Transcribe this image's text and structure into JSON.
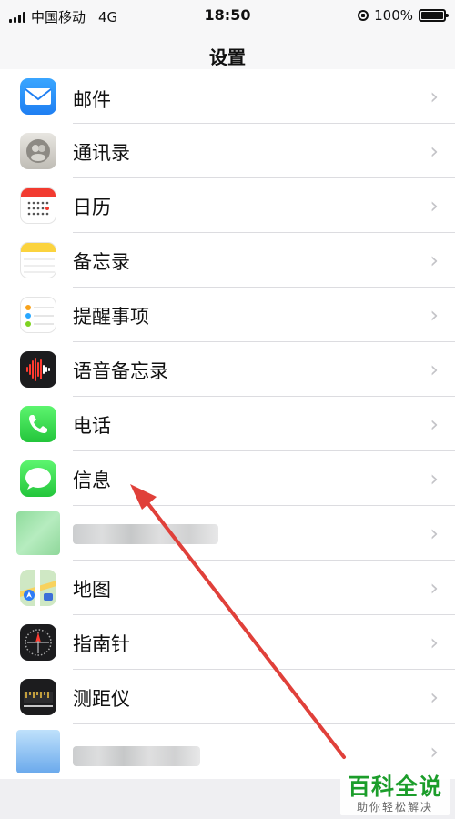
{
  "status_bar": {
    "carrier": "中国移动",
    "network": "4G",
    "time": "18:50",
    "battery_percent": "100%",
    "battery_level": 1.0
  },
  "navbar": {
    "title": "设置"
  },
  "rows": [
    {
      "label": "邮件",
      "icon": "mail-icon"
    },
    {
      "label": "通讯录",
      "icon": "contacts-icon"
    },
    {
      "label": "日历",
      "icon": "calendar-icon"
    },
    {
      "label": "备忘录",
      "icon": "notes-icon"
    },
    {
      "label": "提醒事项",
      "icon": "reminders-icon"
    },
    {
      "label": "语音备忘录",
      "icon": "voice-memos-icon"
    },
    {
      "label": "电话",
      "icon": "phone-icon"
    },
    {
      "label": "信息",
      "icon": "messages-icon"
    },
    {
      "label": "",
      "icon": "blurred-app-icon"
    },
    {
      "label": "地图",
      "icon": "maps-icon"
    },
    {
      "label": "指南针",
      "icon": "compass-icon"
    },
    {
      "label": "测距仪",
      "icon": "measure-icon"
    },
    {
      "label": "",
      "icon": "blurred-app-icon"
    }
  ],
  "chevron": "›",
  "colors": {
    "arrow": "#e0403a",
    "watermark_green": "#1b9d2a"
  },
  "watermark": {
    "main": "百科全说",
    "sub": "助你轻松解决"
  }
}
